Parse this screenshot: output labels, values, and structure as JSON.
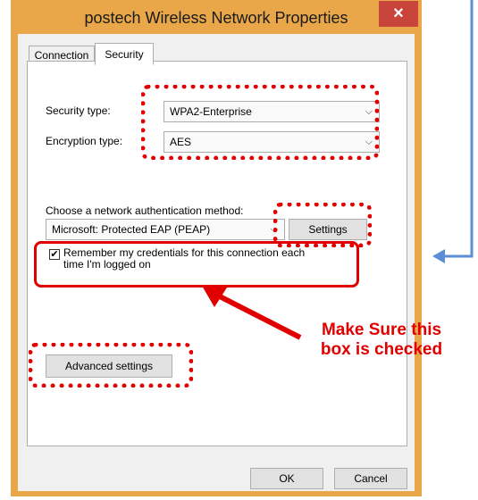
{
  "window": {
    "title": "postech Wireless Network Properties",
    "close_label": "×"
  },
  "tabs": [
    {
      "label": "Connection"
    },
    {
      "label": "Security"
    }
  ],
  "security": {
    "type_label": "Security type:",
    "type_value": "WPA2-Enterprise",
    "encryption_label": "Encryption type:",
    "encryption_value": "AES",
    "auth_label": "Choose a network authentication method:",
    "auth_value": "Microsoft: Protected EAP (PEAP)",
    "settings_label": "Settings",
    "remember_line1": "Remember my credentials for this connection each",
    "remember_line2": "time I'm logged on",
    "remember_checked": "✔",
    "advanced_label": "Advanced settings"
  },
  "footer": {
    "ok_label": "OK",
    "cancel_label": "Cancel"
  },
  "annotation": {
    "line1": "Make Sure this",
    "line2": "box is checked",
    "color": "#e00000"
  },
  "accent": {
    "frame": "#e9a74a",
    "blue_pointer": "#5b8ed6"
  }
}
